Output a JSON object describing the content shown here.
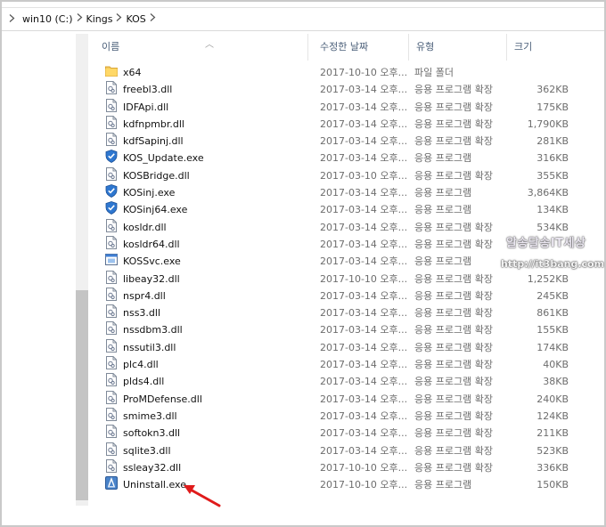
{
  "breadcrumb": [
    "win10 (C:)",
    "Kings",
    "KOS"
  ],
  "columns": {
    "name": "이름",
    "date": "수정한 날짜",
    "type": "유형",
    "size": "크기"
  },
  "watermark": {
    "line1": "알송달송IT세상",
    "line2": "http://it3bang.com"
  },
  "files": [
    {
      "name": "x64",
      "date": "2017-10-10 오후...",
      "type": "파일 폴더",
      "size": "",
      "icon": "folder-icon"
    },
    {
      "name": "freebl3.dll",
      "date": "2017-03-14 오후...",
      "type": "응용 프로그램 확장",
      "size": "362KB",
      "icon": "dll-file-icon"
    },
    {
      "name": "IDFApi.dll",
      "date": "2017-03-14 오후...",
      "type": "응용 프로그램 확장",
      "size": "175KB",
      "icon": "dll-file-icon"
    },
    {
      "name": "kdfnpmbr.dll",
      "date": "2017-03-14 오후...",
      "type": "응용 프로그램 확장",
      "size": "1,790KB",
      "icon": "dll-file-icon"
    },
    {
      "name": "kdfSapinj.dll",
      "date": "2017-03-14 오후...",
      "type": "응용 프로그램 확장",
      "size": "281KB",
      "icon": "dll-file-icon"
    },
    {
      "name": "KOS_Update.exe",
      "date": "2017-03-14 오후...",
      "type": "응용 프로그램",
      "size": "316KB",
      "icon": "shield-exe-icon"
    },
    {
      "name": "KOSBridge.dll",
      "date": "2017-03-10 오후...",
      "type": "응용 프로그램 확장",
      "size": "355KB",
      "icon": "dll-file-icon"
    },
    {
      "name": "KOSinj.exe",
      "date": "2017-03-14 오후...",
      "type": "응용 프로그램",
      "size": "3,864KB",
      "icon": "shield-exe-icon"
    },
    {
      "name": "KOSinj64.exe",
      "date": "2017-03-14 오후...",
      "type": "응용 프로그램",
      "size": "134KB",
      "icon": "shield-exe-icon"
    },
    {
      "name": "kosldr.dll",
      "date": "2017-03-14 오후...",
      "type": "응용 프로그램 확장",
      "size": "534KB",
      "icon": "dll-file-icon"
    },
    {
      "name": "kosldr64.dll",
      "date": "2017-03-14 오후...",
      "type": "응용 프로그램 확장",
      "size": "",
      "icon": "dll-file-icon"
    },
    {
      "name": "KOSSvc.exe",
      "date": "2017-03-14 오후...",
      "type": "응용 프로그램",
      "size": "",
      "icon": "window-exe-icon"
    },
    {
      "name": "libeay32.dll",
      "date": "2017-10-10 오후...",
      "type": "응용 프로그램 확장",
      "size": "1,252KB",
      "icon": "dll-file-icon"
    },
    {
      "name": "nspr4.dll",
      "date": "2017-03-14 오후...",
      "type": "응용 프로그램 확장",
      "size": "245KB",
      "icon": "dll-file-icon"
    },
    {
      "name": "nss3.dll",
      "date": "2017-03-14 오후...",
      "type": "응용 프로그램 확장",
      "size": "861KB",
      "icon": "dll-file-icon"
    },
    {
      "name": "nssdbm3.dll",
      "date": "2017-03-14 오후...",
      "type": "응용 프로그램 확장",
      "size": "155KB",
      "icon": "dll-file-icon"
    },
    {
      "name": "nssutil3.dll",
      "date": "2017-03-14 오후...",
      "type": "응용 프로그램 확장",
      "size": "174KB",
      "icon": "dll-file-icon"
    },
    {
      "name": "plc4.dll",
      "date": "2017-03-14 오후...",
      "type": "응용 프로그램 확장",
      "size": "40KB",
      "icon": "dll-file-icon"
    },
    {
      "name": "plds4.dll",
      "date": "2017-03-14 오후...",
      "type": "응용 프로그램 확장",
      "size": "38KB",
      "icon": "dll-file-icon"
    },
    {
      "name": "ProMDefense.dll",
      "date": "2017-03-14 오후...",
      "type": "응용 프로그램 확장",
      "size": "240KB",
      "icon": "dll-file-icon"
    },
    {
      "name": "smime3.dll",
      "date": "2017-03-14 오후...",
      "type": "응용 프로그램 확장",
      "size": "124KB",
      "icon": "dll-file-icon"
    },
    {
      "name": "softokn3.dll",
      "date": "2017-03-14 오후...",
      "type": "응용 프로그램 확장",
      "size": "211KB",
      "icon": "dll-file-icon"
    },
    {
      "name": "sqlite3.dll",
      "date": "2017-03-14 오후...",
      "type": "응용 프로그램 확장",
      "size": "523KB",
      "icon": "dll-file-icon"
    },
    {
      "name": "ssleay32.dll",
      "date": "2017-10-10 오후...",
      "type": "응용 프로그램 확장",
      "size": "336KB",
      "icon": "dll-file-icon"
    },
    {
      "name": "Uninstall.exe",
      "date": "2017-10-10 오후...",
      "type": "응용 프로그램",
      "size": "150KB",
      "icon": "installer-exe-icon"
    }
  ]
}
